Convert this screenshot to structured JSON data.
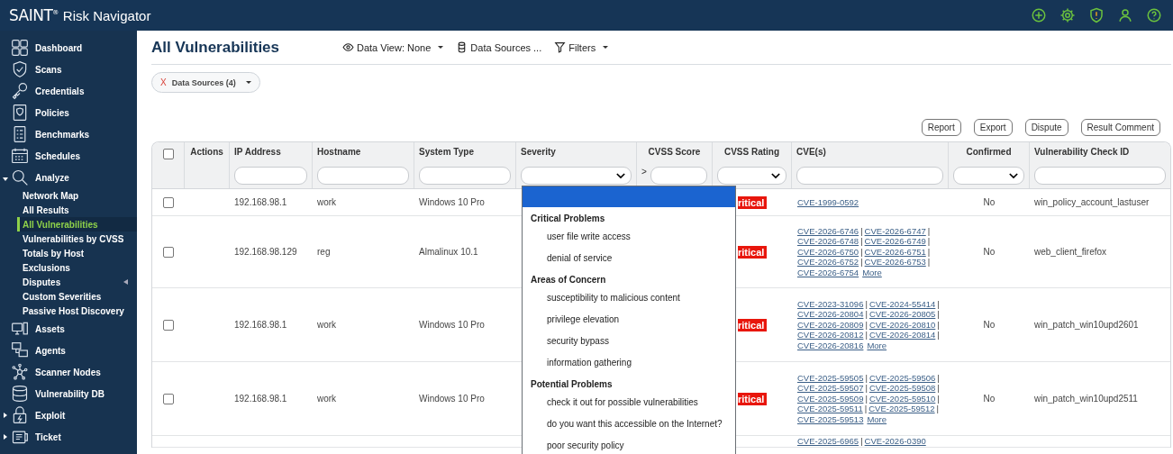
{
  "app": {
    "brand": "SAINT",
    "brand_mark": "®",
    "title": "Risk Navigator"
  },
  "sidebar": {
    "items": [
      {
        "label": "Dashboard"
      },
      {
        "label": "Scans"
      },
      {
        "label": "Credentials"
      },
      {
        "label": "Policies"
      },
      {
        "label": "Benchmarks"
      },
      {
        "label": "Schedules"
      },
      {
        "label": "Analyze",
        "expanded": true,
        "children": [
          {
            "label": "Network Map",
            "selected": false,
            "submenu": false
          },
          {
            "label": "All Results",
            "selected": false,
            "submenu": false
          },
          {
            "label": "All Vulnerabilities",
            "selected": true,
            "submenu": false
          },
          {
            "label": "Vulnerabilities by CVSS",
            "selected": false,
            "submenu": false
          },
          {
            "label": "Totals by Host",
            "selected": false,
            "submenu": false
          },
          {
            "label": "Exclusions",
            "selected": false,
            "submenu": false
          },
          {
            "label": "Disputes",
            "selected": false,
            "submenu": true
          },
          {
            "label": "Custom Severities",
            "selected": false,
            "submenu": false
          },
          {
            "label": "Passive Host Discovery",
            "selected": false,
            "submenu": false
          }
        ]
      },
      {
        "label": "Assets"
      },
      {
        "label": "Agents"
      },
      {
        "label": "Scanner Nodes"
      },
      {
        "label": "Vulnerability DB"
      },
      {
        "label": "Exploit",
        "expanded": false
      },
      {
        "label": "Ticket",
        "expanded": false
      }
    ]
  },
  "page": {
    "title": "All Vulnerabilities",
    "toolbar": [
      {
        "label": "Data View: None",
        "caret": true
      },
      {
        "label": "Data Sources ...",
        "caret": false
      },
      {
        "label": "Filters",
        "caret": true
      }
    ],
    "chip": {
      "remove": "X",
      "label": "Data Sources (4)"
    },
    "actions": [
      "Report",
      "Export",
      "Dispute",
      "Result Comment"
    ]
  },
  "table": {
    "columns": [
      {
        "kind": "checkbox",
        "checked": false
      },
      {
        "label": "Actions",
        "kind": "none"
      },
      {
        "label": "IP Address",
        "kind": "text"
      },
      {
        "label": "Hostname",
        "kind": "text"
      },
      {
        "label": "System Type",
        "kind": "text"
      },
      {
        "label": "Severity",
        "kind": "select"
      },
      {
        "label": "CVSS Score",
        "kind": "text",
        "prefix": ">"
      },
      {
        "label": "CVSS Rating",
        "kind": "select"
      },
      {
        "label": "CVE(s)",
        "kind": "text"
      },
      {
        "label": "Confirmed",
        "kind": "select"
      },
      {
        "label": "Vulnerability Check ID",
        "kind": "text"
      }
    ],
    "separator": "|",
    "rows": [
      {
        "checked": false,
        "ip": "192.168.98.1",
        "hostname": "work",
        "system_type": "Windows 10 Pro",
        "rating": "ritical",
        "cves": [
          "CVE-1999-0592"
        ],
        "confirmed": "No",
        "check_id": "win_policy_account_lastuser"
      },
      {
        "checked": false,
        "ip": "192.168.98.129",
        "hostname": "reg",
        "system_type": "Almalinux 10.1",
        "rating": "ritical",
        "cves": [
          "CVE-2026-6746",
          "CVE-2026-6747",
          "CVE-2026-6748",
          "CVE-2026-6749",
          "CVE-2026-6750",
          "CVE-2026-6751",
          "CVE-2026-6752",
          "CVE-2026-6753",
          "CVE-2026-6754"
        ],
        "more": "More",
        "confirmed": "No",
        "check_id": "web_client_firefox"
      },
      {
        "checked": false,
        "ip": "192.168.98.1",
        "hostname": "work",
        "system_type": "Windows 10 Pro",
        "rating": "ritical",
        "cves": [
          "CVE-2023-31096",
          "CVE-2024-55414",
          "CVE-2026-20804",
          "CVE-2026-20805",
          "CVE-2026-20809",
          "CVE-2026-20810",
          "CVE-2026-20812",
          "CVE-2026-20814",
          "CVE-2026-20816"
        ],
        "more": "More",
        "confirmed": "No",
        "check_id": "win_patch_win10upd2601"
      },
      {
        "checked": false,
        "ip": "192.168.98.1",
        "hostname": "work",
        "system_type": "Windows 10 Pro",
        "rating": "ritical",
        "cves": [
          "CVE-2025-59505",
          "CVE-2025-59506",
          "CVE-2025-59507",
          "CVE-2025-59508",
          "CVE-2025-59509",
          "CVE-2025-59510",
          "CVE-2025-59511",
          "CVE-2025-59512",
          "CVE-2025-59513"
        ],
        "more": "More",
        "confirmed": "No",
        "check_id": "win_patch_win10upd2511"
      },
      {
        "cves": [
          "CVE-2025-6965",
          "CVE-2026-0390"
        ]
      }
    ]
  },
  "severity_dropdown": {
    "empty_option": {
      "selected": true
    },
    "groups": [
      {
        "label": "Critical Problems",
        "options": [
          {
            "label": "user file write access",
            "selected": false
          },
          {
            "label": "denial of service",
            "selected": false
          }
        ]
      },
      {
        "label": "Areas of Concern",
        "options": [
          {
            "label": "susceptibility to malicious content",
            "selected": false
          },
          {
            "label": "privilege elevation",
            "selected": false
          },
          {
            "label": "security bypass",
            "selected": false
          },
          {
            "label": "information gathering",
            "selected": false
          }
        ]
      },
      {
        "label": "Potential Problems",
        "options": [
          {
            "label": "check it out for possible vulnerabilities",
            "selected": false
          },
          {
            "label": "do you want this accessible on the Internet?",
            "selected": false
          },
          {
            "label": "poor security policy",
            "selected": false
          }
        ]
      }
    ]
  }
}
